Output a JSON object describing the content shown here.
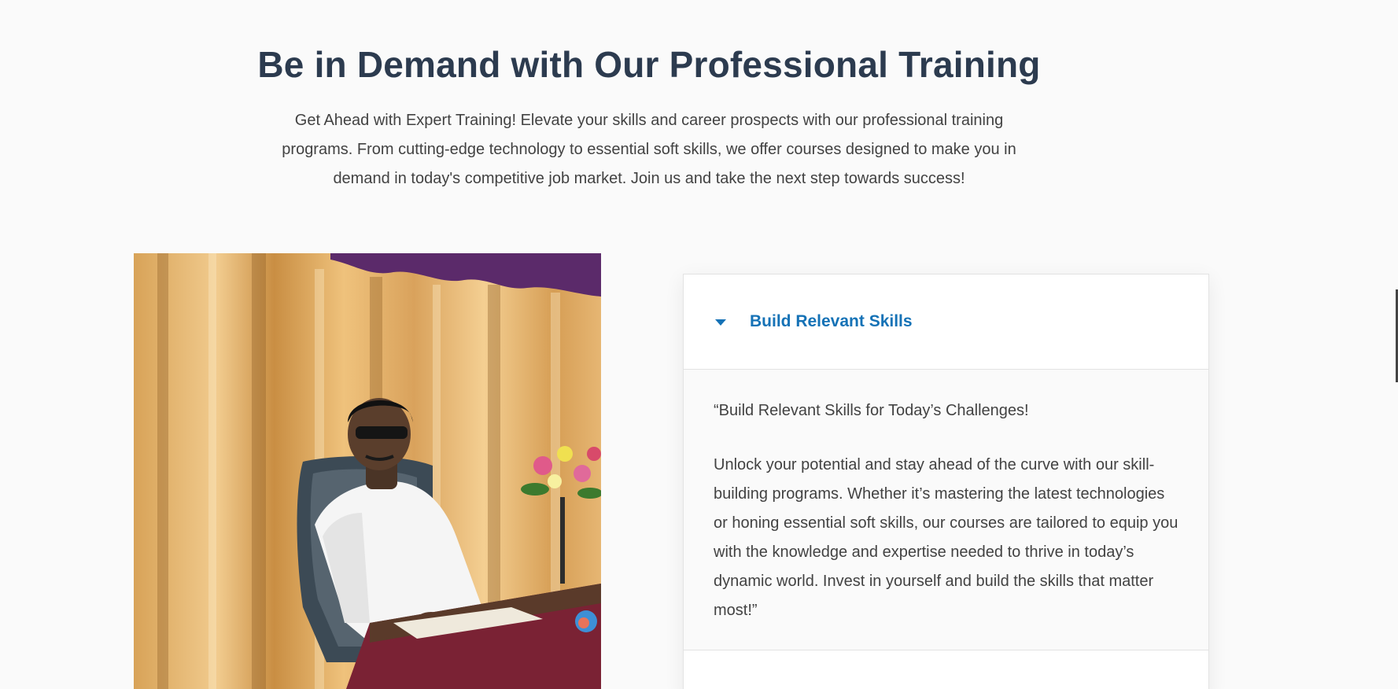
{
  "section": {
    "headline": "Be in Demand with Our Professional Training",
    "lead": "Get Ahead with Expert Training! Elevate your skills and career prospects with our professional training programs. From cutting-edge technology to essential soft skills, we offer courses designed to make you in demand in today's competitive job market. Join us and take the next step towards success!"
  },
  "accordion": {
    "item_title": "Build Relevant Skills",
    "caret_icon": "caret-down-icon",
    "body_intro": "“Build Relevant Skills for Today’s Challenges!",
    "body_text": "Unlock your potential and stay ahead of the curve with our skill-building programs. Whether it’s mastering the latest technologies or honing essential soft skills, our courses are tailored to equip you with the knowledge and expertise needed to thrive in today’s dynamic world. Invest in yourself and build the skills that matter most!”"
  },
  "colors": {
    "accent": "#1572b6",
    "headline": "#2c3b4f",
    "body_text": "#424242",
    "background": "#fafafa"
  }
}
